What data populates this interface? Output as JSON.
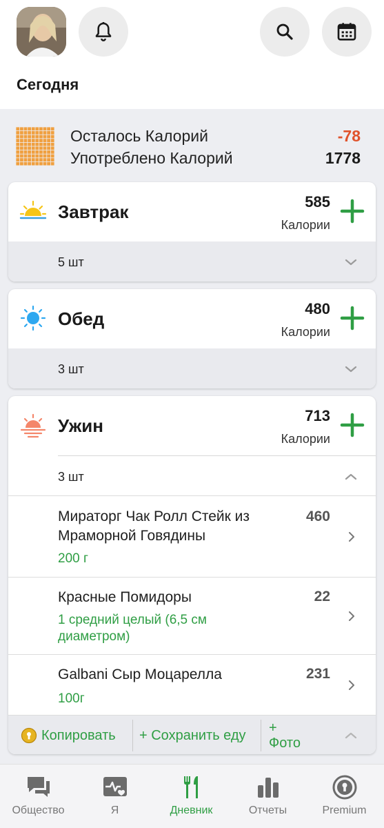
{
  "header": {
    "title": "Сегодня"
  },
  "summary": {
    "remaining_label": "Осталось Калорий",
    "remaining_value": "-78",
    "remaining_color": "#e0532c",
    "consumed_label": "Употреблено Калорий",
    "consumed_value": "1778"
  },
  "meals": {
    "breakfast": {
      "name": "Завтрак",
      "calories": "585",
      "calories_label": "Калории",
      "count": "5 шт"
    },
    "lunch": {
      "name": "Обед",
      "calories": "480",
      "calories_label": "Калории",
      "count": "3 шт"
    },
    "dinner": {
      "name": "Ужин",
      "calories": "713",
      "calories_label": "Калории",
      "count": "3 шт",
      "items": [
        {
          "name": "Мираторг Чак Ролл Стейк из Мраморной Говядины",
          "portion": "200 г",
          "calories": "460"
        },
        {
          "name": "Красные Помидоры",
          "portion": "1 средний целый (6,5 см диаметром)",
          "calories": "22"
        },
        {
          "name": "Galbani Сыр Моцарелла",
          "portion": "100г",
          "calories": "231"
        }
      ],
      "actions": {
        "copy": "Копировать",
        "save": "+ Сохранить еду",
        "photo_line1": "+",
        "photo_line2": "Фото"
      }
    }
  },
  "tabs": [
    {
      "label": "Общество",
      "icon": "chat-icon"
    },
    {
      "label": "Я",
      "icon": "heart-monitor-icon"
    },
    {
      "label": "Дневник",
      "icon": "fork-knife-icon",
      "active": true
    },
    {
      "label": "Отчеты",
      "icon": "bar-chart-icon"
    },
    {
      "label": "Premium",
      "icon": "premium-badge-icon"
    }
  ],
  "colors": {
    "accent_green": "#2f9e44",
    "negative": "#e0532c",
    "grid_orange": "#f0a040"
  }
}
